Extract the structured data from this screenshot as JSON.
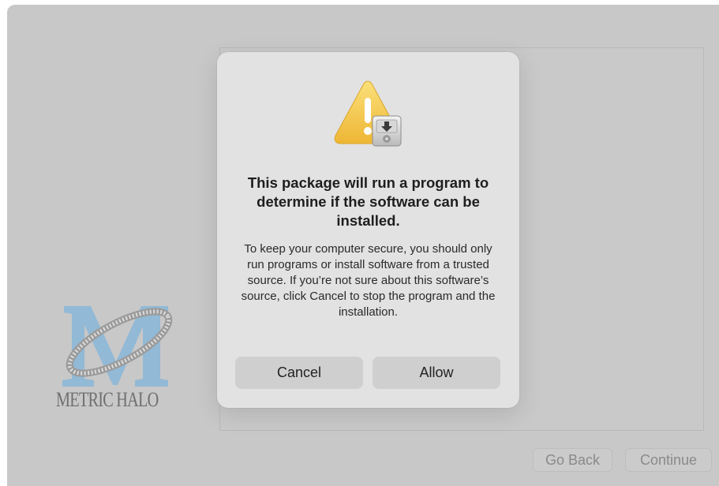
{
  "installer": {
    "brand_logo_text": "METRIC HALO",
    "nav": {
      "go_back_label": "Go Back",
      "continue_label": "Continue"
    }
  },
  "dialog": {
    "icon": "warning-package-icon",
    "title": "This package will run a program to determine if the software can be installed.",
    "body": "To keep your computer secure, you should only run programs or install software from a trusted source. If you’re not sure about this software’s source, click Cancel to stop the program and the installation.",
    "cancel_label": "Cancel",
    "allow_label": "Allow"
  },
  "colors": {
    "window_background": "#c8c8c8",
    "dialog_background": "#e2e2e2",
    "warning_yellow": "#f2c84b",
    "logo_blue": "#8fb8d6"
  }
}
